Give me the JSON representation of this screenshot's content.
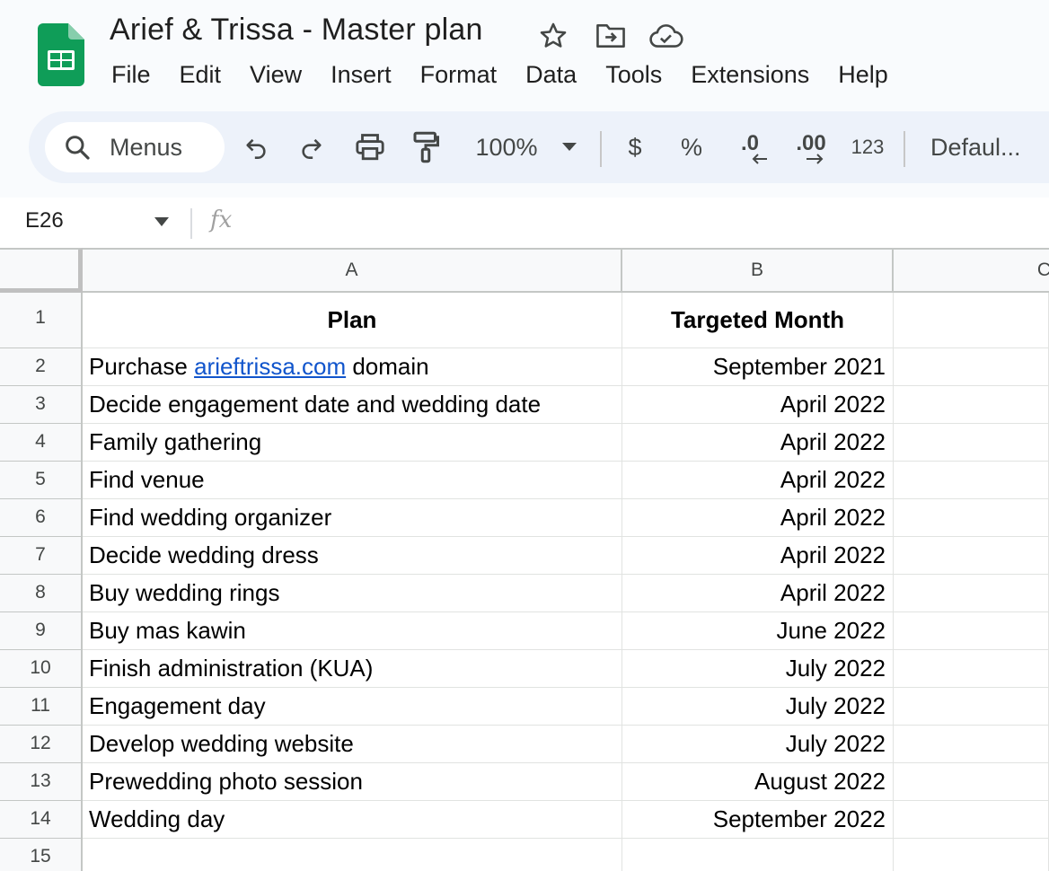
{
  "window": {
    "title": "Arief & Trissa - Master plan"
  },
  "menu": [
    "File",
    "Edit",
    "View",
    "Insert",
    "Format",
    "Data",
    "Tools",
    "Extensions",
    "Help"
  ],
  "toolbar": {
    "search_label": "Menus",
    "zoom": "100%",
    "currency": "$",
    "percent": "%",
    "decrease_decimal": ".0",
    "increase_decimal": ".00",
    "number_format": "123",
    "font": "Defaul..."
  },
  "formula_bar": {
    "name_box": "E26",
    "fx": "fx"
  },
  "grid": {
    "columns": [
      "A",
      "B",
      "C"
    ],
    "rows": [
      "1",
      "2",
      "3",
      "4",
      "5",
      "6",
      "7",
      "8",
      "9",
      "10",
      "11",
      "12",
      "13",
      "14",
      "15"
    ],
    "header": {
      "plan": "Plan",
      "month": "Targeted Month"
    },
    "row2": {
      "prefix": "Purchase ",
      "link": "arieftrissa.com",
      "suffix": " domain",
      "month": "September 2021"
    },
    "items": [
      {
        "plan": "Decide engagement date and wedding date",
        "month": "April 2022"
      },
      {
        "plan": "Family gathering",
        "month": "April 2022"
      },
      {
        "plan": "Find venue",
        "month": "April 2022"
      },
      {
        "plan": "Find wedding organizer",
        "month": "April 2022"
      },
      {
        "plan": "Decide wedding dress",
        "month": "April 2022"
      },
      {
        "plan": "Buy wedding rings",
        "month": "April 2022"
      },
      {
        "plan": "Buy mas kawin",
        "month": "June 2022"
      },
      {
        "plan": "Finish administration (KUA)",
        "month": "July 2022"
      },
      {
        "plan": "Engagement day",
        "month": "July 2022"
      },
      {
        "plan": "Develop wedding website",
        "month": "July 2022"
      },
      {
        "plan": "Prewedding photo session",
        "month": "August 2022"
      },
      {
        "plan": "Wedding day",
        "month": "September 2022"
      }
    ]
  },
  "colors": {
    "brand_green": "#0f9d58",
    "link_blue": "#1155cc",
    "toolbar_bg": "#edf2fa"
  },
  "icons": [
    "sheets-logo-icon",
    "star-icon",
    "move-folder-icon",
    "cloud-saved-icon",
    "search-icon",
    "undo-icon",
    "redo-icon",
    "print-icon",
    "paint-format-icon",
    "caret-down-icon"
  ]
}
